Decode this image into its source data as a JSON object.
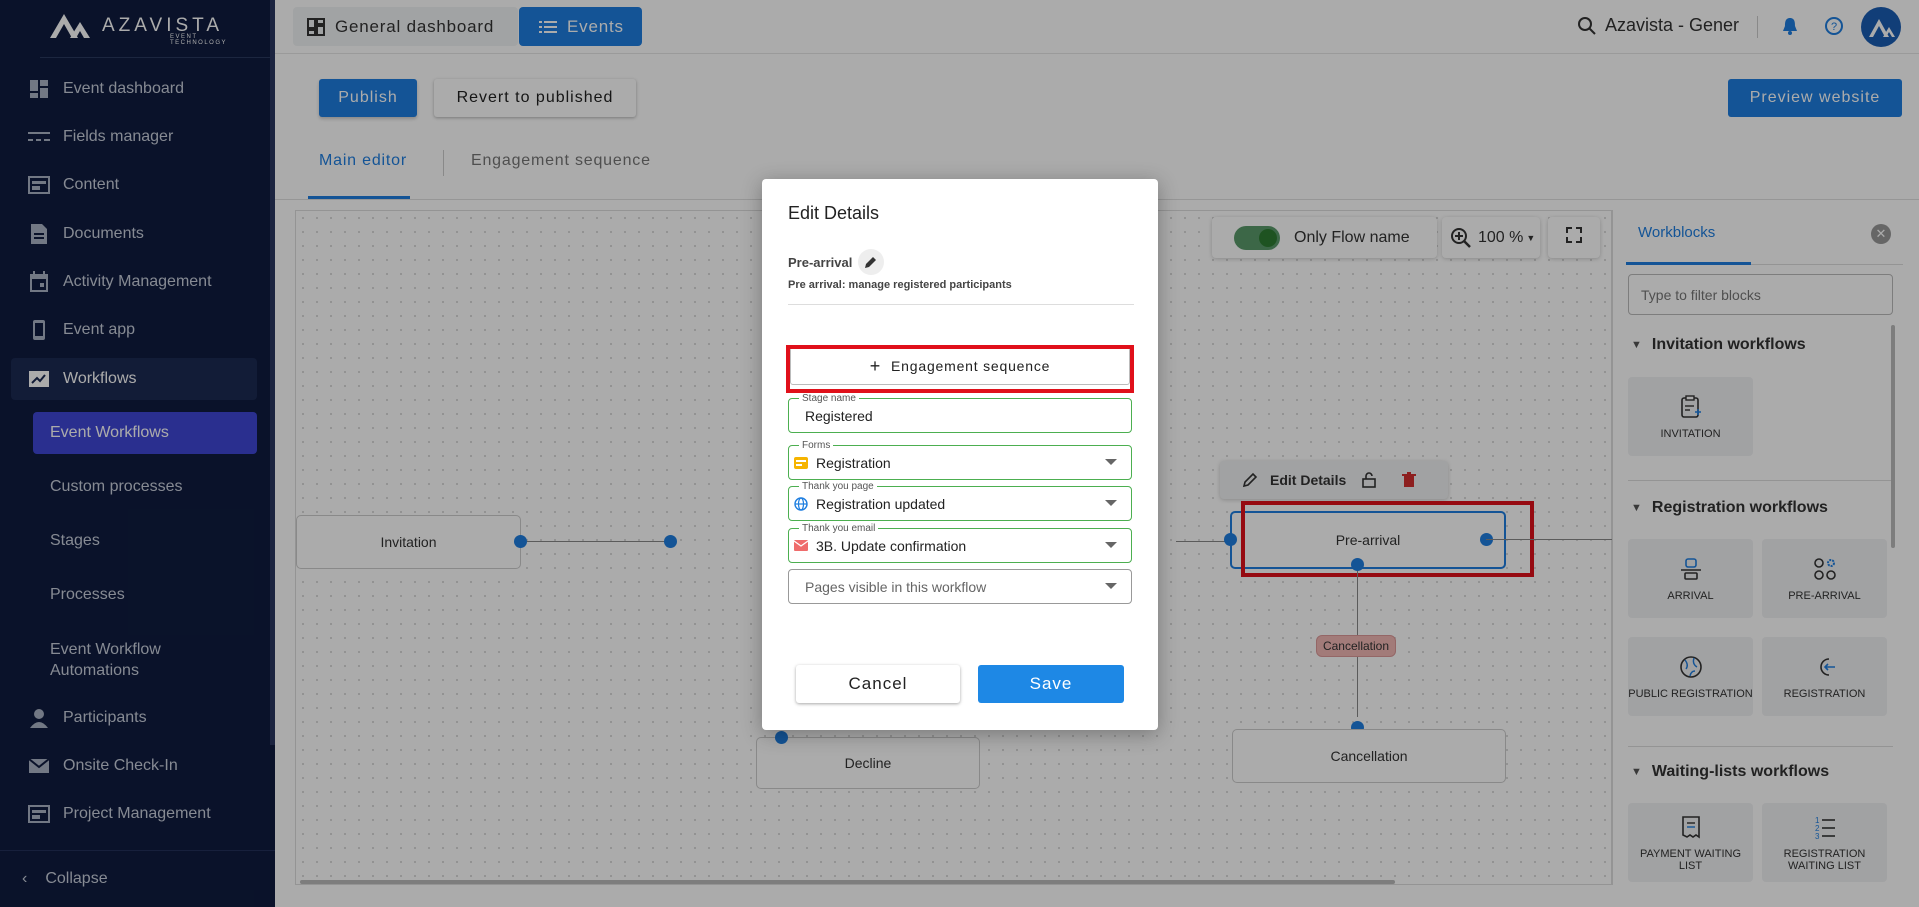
{
  "brand": {
    "name": "AZAVISTA",
    "tagline": "EVENT TECHNOLOGY"
  },
  "sidebar": {
    "items": [
      {
        "label": "Event dashboard",
        "icon": "dashboard-icon"
      },
      {
        "label": "Fields manager",
        "icon": "fields-icon"
      },
      {
        "label": "Content",
        "icon": "content-icon"
      },
      {
        "label": "Documents",
        "icon": "document-icon"
      },
      {
        "label": "Activity Management",
        "icon": "calendar-icon"
      },
      {
        "label": "Event app",
        "icon": "phone-icon"
      },
      {
        "label": "Workflows",
        "icon": "workflow-icon"
      }
    ],
    "sub_items": [
      {
        "label": "Event Workflows"
      },
      {
        "label": "Custom processes"
      },
      {
        "label": "Stages"
      },
      {
        "label": "Processes"
      },
      {
        "label": "Event Workflow Automations"
      }
    ],
    "items2": [
      {
        "label": "Participants",
        "icon": "person-icon"
      },
      {
        "label": "Onsite Check-In",
        "icon": "mail-icon"
      },
      {
        "label": "Project Management",
        "icon": "project-icon"
      }
    ],
    "collapse_label": "Collapse"
  },
  "topbar": {
    "general_dashboard": "General dashboard",
    "events": "Events",
    "search_text": "Azavista - Gener"
  },
  "toolbar": {
    "publish": "Publish",
    "revert": "Revert to published",
    "preview": "Preview website"
  },
  "tabs": {
    "main_editor": "Main editor",
    "engagement": "Engagement sequence"
  },
  "canvas": {
    "toggle_label": "Only Flow name",
    "zoom": "100 %",
    "nodes": {
      "invitation": "Invitation",
      "pre_arrival": "Pre-arrival",
      "cancellation": "Cancellation",
      "decline": "Decline"
    },
    "edge_label": "Cancellation",
    "node_toolbar": {
      "edit": "Edit Details"
    }
  },
  "workblocks": {
    "title": "Workblocks",
    "filter_placeholder": "Type to filter blocks",
    "sections": {
      "invitation": "Invitation workflows",
      "registration": "Registration workflows",
      "waiting": "Waiting-lists workflows"
    },
    "cards": {
      "invitation": "INVITATION",
      "arrival": "ARRIVAL",
      "pre_arrival": "PRE-ARRIVAL",
      "public_reg": "PUBLIC REGISTRATION",
      "registration": "REGISTRATION",
      "payment_wl": "PAYMENT WAITING LIST",
      "reg_wl": "REGISTRATION WAITING LIST"
    }
  },
  "modal": {
    "title": "Edit Details",
    "stage": "Pre-arrival",
    "description": "Pre arrival: manage registered participants",
    "engagement_btn": "Engagement sequence",
    "stage_name": {
      "label": "Stage name",
      "value": "Registered"
    },
    "forms": {
      "label": "Forms",
      "value": "Registration"
    },
    "thank_page": {
      "label": "Thank you page",
      "value": "Registration updated"
    },
    "thank_email": {
      "label": "Thank you email",
      "value": "3B. Update confirmation"
    },
    "pages_visible": {
      "placeholder": "Pages visible in this workflow"
    },
    "cancel": "Cancel",
    "save": "Save"
  },
  "colors": {
    "primary": "#1e7ee0",
    "sidebar_bg": "#0f1c3f",
    "highlight": "#e0101a",
    "selected_sub": "#3f47d6"
  }
}
